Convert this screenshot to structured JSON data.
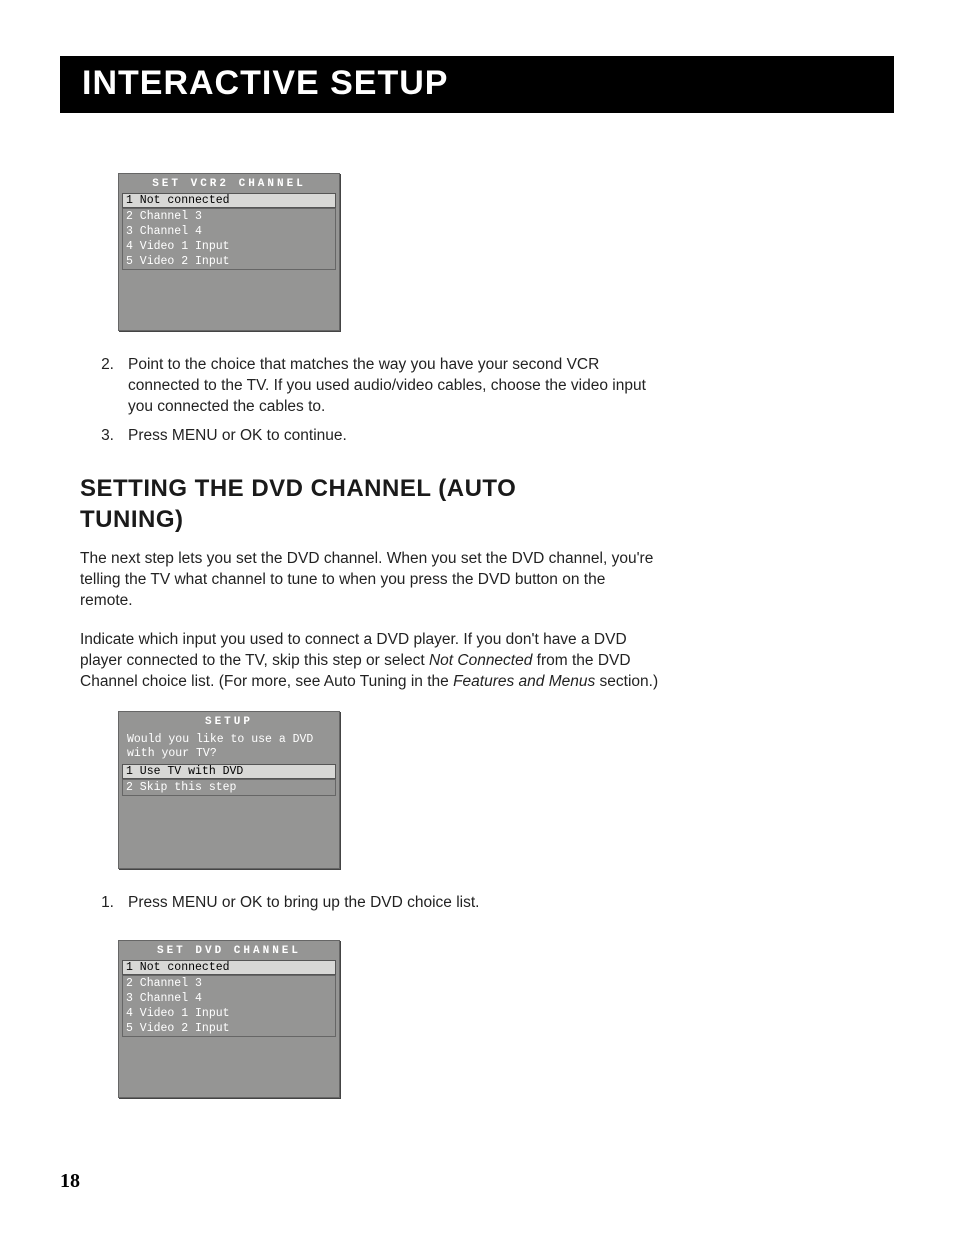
{
  "header": {
    "title": "Interactive Setup"
  },
  "osd1": {
    "title": "SET VCR2 CHANNEL",
    "selected": "1 Not connected",
    "items": [
      "2 Channel 3",
      "3 Channel 4",
      "4 Video 1 Input",
      "5 Video 2 Input"
    ]
  },
  "steps_a": [
    {
      "n": "2.",
      "t": "Point to the choice that matches the way you have your second VCR connected to the TV.  If you used audio/video cables, choose the video input you connected the cables to."
    },
    {
      "n": "3.",
      "t": "Press MENU or OK to continue."
    }
  ],
  "section": {
    "heading": "Setting the DVD Channel (Auto Tuning)"
  },
  "para1": "The next step lets you set the DVD channel. When you set the DVD channel, you're telling the TV what channel to tune to when you press the DVD button on the remote.",
  "para2_pre": "Indicate which input you used to connect a DVD player. If you don't have a DVD player connected to the TV, skip this step or select ",
  "para2_em1": "Not Connected",
  "para2_mid": " from the DVD Channel choice list. (For more, see Auto Tuning in the ",
  "para2_em2": "Features and Menus",
  "para2_post": " section.)",
  "osd2": {
    "title": "SETUP",
    "prompt": "Would you like to use a DVD with your TV?",
    "selected": "1 Use TV with DVD",
    "items": [
      "2 Skip this step"
    ]
  },
  "steps_b": [
    {
      "n": "1.",
      "t": "Press MENU or OK to bring up the DVD choice list."
    }
  ],
  "osd3": {
    "title": "SET DVD CHANNEL",
    "selected": "1 Not connected",
    "items": [
      "2 Channel 3",
      "3 Channel 4",
      "4 Video 1 Input",
      "5 Video 2 Input"
    ]
  },
  "page_number": "18"
}
